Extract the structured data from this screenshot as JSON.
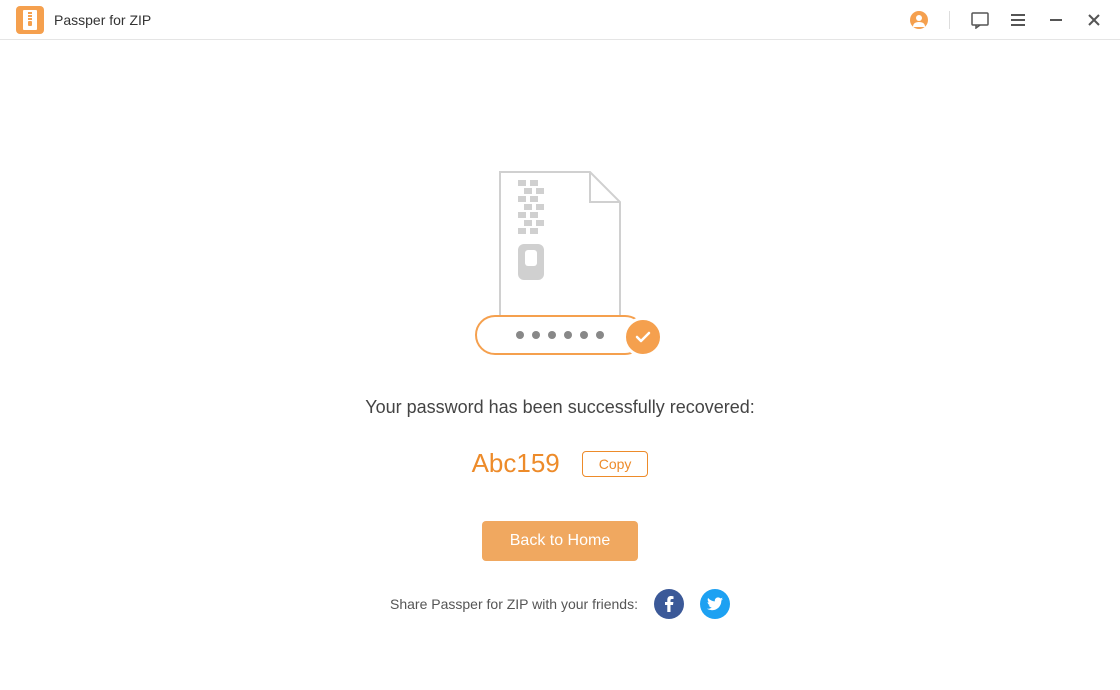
{
  "app": {
    "title": "Passper for ZIP"
  },
  "main": {
    "success_message": "Your password has been successfully recovered:",
    "recovered_password": "Abc159",
    "copy_label": "Copy",
    "home_label": "Back to Home",
    "share_text": "Share Passper for ZIP with your friends:"
  },
  "icons": {
    "user": "user-icon",
    "feedback": "comment-icon",
    "menu": "menu-icon",
    "minimize": "minimize-icon",
    "close": "close-icon",
    "facebook": "facebook-icon",
    "twitter": "twitter-icon"
  },
  "colors": {
    "accent": "#f5a04e",
    "accent_dark": "#ed8b2a",
    "button": "#f0a860",
    "facebook": "#3b5998",
    "twitter": "#1da1f2"
  }
}
